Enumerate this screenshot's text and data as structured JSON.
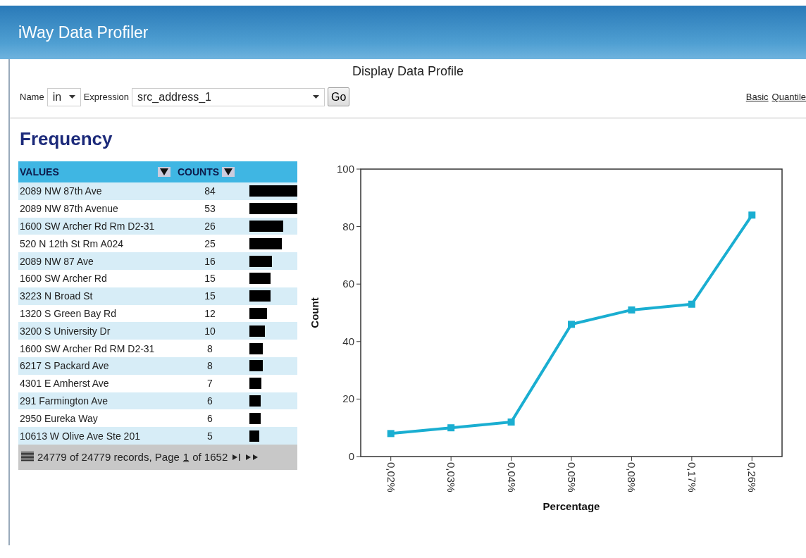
{
  "app_title": "iWay Data Profiler",
  "page_title": "Display Data Profile",
  "filter": {
    "name_label": "Name",
    "name_value": "in",
    "expression_label": "Expression",
    "expression_value": "src_address_1",
    "go_button": "Go"
  },
  "links": [
    "Basic",
    "Quantile"
  ],
  "section_title": "Frequency",
  "table": {
    "columns": [
      "VALUES",
      "COUNTS"
    ],
    "rows": [
      {
        "value": "2089 NW 87th Ave",
        "count": "84"
      },
      {
        "value": "2089 NW 87th Avenue",
        "count": "53"
      },
      {
        "value": "1600 SW Archer Rd Rm D2-31",
        "count": "26"
      },
      {
        "value": "520 N 12th St Rm A024",
        "count": "25"
      },
      {
        "value": "2089 NW 87 Ave",
        "count": "16"
      },
      {
        "value": "1600 SW Archer Rd",
        "count": "15"
      },
      {
        "value": "3223 N Broad St",
        "count": "15"
      },
      {
        "value": "1320 S Green Bay Rd",
        "count": "12"
      },
      {
        "value": "3200 S University Dr",
        "count": "10"
      },
      {
        "value": "1600 SW Archer Rd RM D2-31",
        "count": "8"
      },
      {
        "value": "6217 S Packard Ave",
        "count": "8"
      },
      {
        "value": "4301 E Amherst Ave",
        "count": "7"
      },
      {
        "value": "291 Farmington Ave",
        "count": "6"
      },
      {
        "value": "2950 Eureka Way",
        "count": "6"
      },
      {
        "value": "10613 W Olive Ave Ste 201",
        "count": "5"
      }
    ],
    "pager": {
      "records": "24779 of 24779 records, Page",
      "page": "1",
      "total": "of 1652"
    }
  },
  "chart_data": {
    "type": "line",
    "xlabel": "Percentage",
    "ylabel": "Count",
    "categories": [
      "0,02%",
      "0,03%",
      "0,04%",
      "0,05%",
      "0,08%",
      "0,17%",
      "0,26%"
    ],
    "series": [
      {
        "color": "#1aaed1",
        "marker": "square",
        "values": [
          8,
          10,
          12,
          46,
          51,
          53,
          84
        ]
      }
    ],
    "ylim": [
      0,
      100
    ],
    "yticks": [
      0,
      20,
      40,
      60,
      80,
      100
    ]
  }
}
